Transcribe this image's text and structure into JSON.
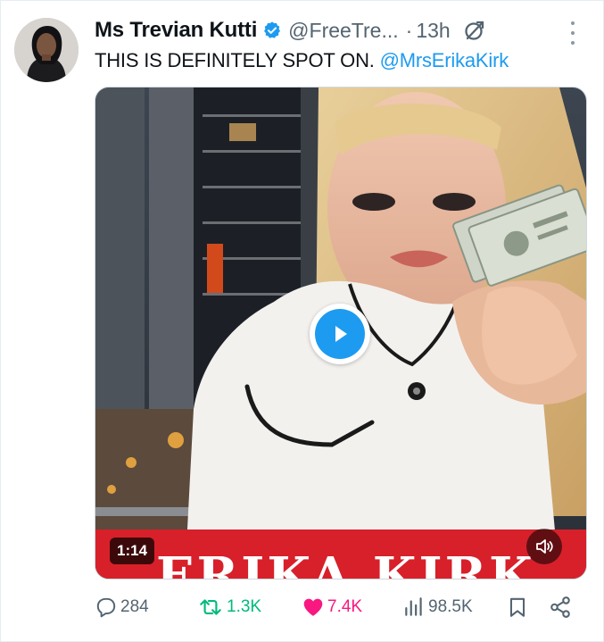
{
  "tweet": {
    "author_name": "Ms Trevian Kutti",
    "handle": "@FreeTre...",
    "separator": "·",
    "time": "13h",
    "text": "THIS IS DEFINITELY SPOT ON.",
    "mention": "@MrsErikaKirk"
  },
  "media": {
    "duration": "1:14",
    "banner_text": "ERIKA KIRK",
    "banner_color": "#d8202a"
  },
  "actions": {
    "replies": "284",
    "reposts": "1.3K",
    "likes": "7.4K",
    "views": "98.5K"
  },
  "colors": {
    "accent": "#1d9bf0",
    "repost": "#00ba7c",
    "like": "#f91880",
    "muted": "#536471"
  },
  "icons": {
    "verified": "verified-badge-icon",
    "grok": "grok-icon",
    "more": "more-icon",
    "play": "play-icon",
    "mute": "volume-icon",
    "reply": "reply-icon",
    "repost": "repost-icon",
    "like": "heart-icon",
    "views": "views-icon",
    "bookmark": "bookmark-icon",
    "share": "share-icon"
  }
}
